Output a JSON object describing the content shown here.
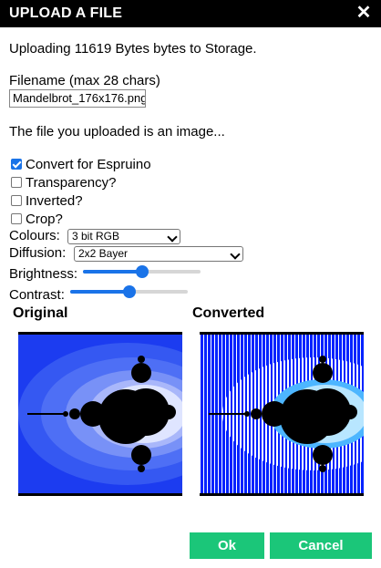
{
  "dialog": {
    "title": "UPLOAD A FILE",
    "close_icon": "close-icon",
    "message": "Uploading 11619 Bytes bytes to Storage.",
    "filename_label": "Filename (max 28 chars)",
    "filename_value": "Mandelbrot_176x176.png",
    "image_notice": "The file you uploaded is an image...",
    "options": [
      {
        "label": "Convert for Espruino",
        "checked": true
      },
      {
        "label": "Transparency?",
        "checked": false
      },
      {
        "label": "Inverted?",
        "checked": false
      },
      {
        "label": "Crop?",
        "checked": false
      }
    ],
    "colours_label": "Colours:",
    "colours_value": "3 bit RGB",
    "diffusion_label": "Diffusion:",
    "diffusion_value": "2x2 Bayer",
    "brightness_label": "Brightness:",
    "brightness_level": 0.5,
    "contrast_label": "Contrast:",
    "contrast_level": 0.5,
    "original_heading": "Original",
    "converted_heading": "Converted",
    "ok_label": "Ok",
    "cancel_label": "Cancel",
    "colors": {
      "accent": "#1a73e8",
      "button": "#1bc679",
      "titlebar": "#000000"
    }
  }
}
